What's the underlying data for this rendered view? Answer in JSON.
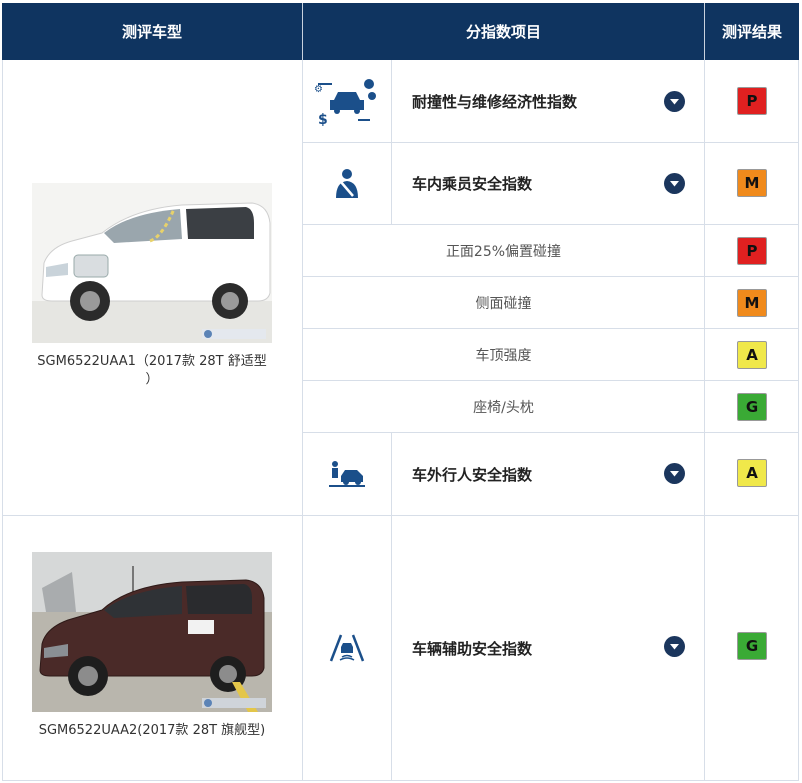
{
  "header": {
    "col_model": "测评车型",
    "col_items": "分指数项目",
    "col_result": "测评结果"
  },
  "vehicles": [
    {
      "caption_line1": "SGM6522UAA1（2017款 28T 舒适型",
      "caption_line2": "）"
    },
    {
      "caption": "SGM6522UAA2(2017款 28T 旗舰型)"
    }
  ],
  "rows": {
    "repair": {
      "label": "耐撞性与维修经济性指数",
      "rating": "P",
      "color": "#e02020",
      "icon": "car-repair-economy-icon"
    },
    "occupant": {
      "label": "车内乘员安全指数",
      "rating": "M",
      "color": "#f08a1c",
      "icon": "seatbelt-occupant-icon"
    },
    "frontal25": {
      "label": "正面25%偏置碰撞",
      "rating": "P",
      "color": "#e02020"
    },
    "side": {
      "label": "侧面碰撞",
      "rating": "M",
      "color": "#f08a1c"
    },
    "roof": {
      "label": "车顶强度",
      "rating": "A",
      "color": "#f0e84a"
    },
    "seat": {
      "label": "座椅/头枕",
      "rating": "G",
      "color": "#3aaa35"
    },
    "pedestrian": {
      "label": "车外行人安全指数",
      "rating": "A",
      "color": "#f0e84a",
      "icon": "pedestrian-car-icon"
    },
    "assist": {
      "label": "车辆辅助安全指数",
      "rating": "G",
      "color": "#3aaa35",
      "icon": "lane-assist-icon"
    }
  }
}
